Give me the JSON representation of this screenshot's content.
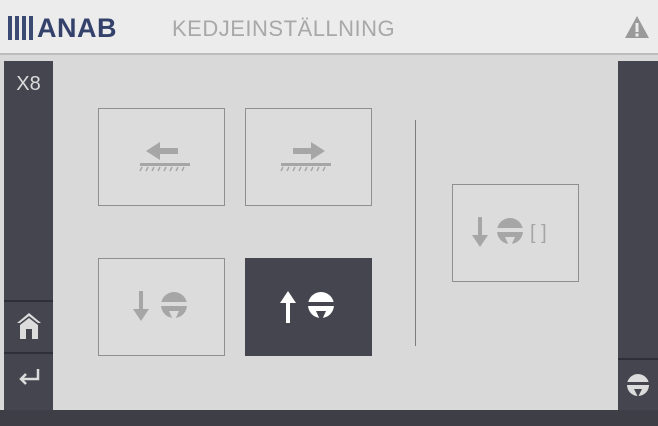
{
  "header": {
    "brand": "ANAB",
    "title": "KEDJEINSTÄLLNING",
    "warning_icon": "warning-icon"
  },
  "sidebar": {
    "station": "X8",
    "items": [
      {
        "icon": "home-icon"
      },
      {
        "icon": "return-arrow-icon"
      }
    ]
  },
  "right_sidebar": {
    "items": [
      {
        "icon": "saw-blade-icon"
      }
    ]
  },
  "controls": {
    "move_left": {
      "icons": [
        "arrow-left-icon",
        "chain-bar-icon"
      ]
    },
    "move_right": {
      "icons": [
        "arrow-right-icon",
        "chain-bar-icon"
      ]
    },
    "blade_down": {
      "icons": [
        "arrow-down-icon",
        "saw-blade-icon"
      ]
    },
    "blade_up": {
      "icons": [
        "arrow-up-icon",
        "saw-blade-icon"
      ],
      "state": "active"
    },
    "blade_reset": {
      "icons": [
        "arrow-down-icon",
        "saw-blade-icon"
      ],
      "suffix": "[ ]"
    }
  },
  "colors": {
    "brand": "#33416b",
    "panel_dark": "#45454f",
    "background": "#d9d9d9",
    "icon_disabled": "#a6a6a6",
    "icon_active": "#ffffff"
  }
}
